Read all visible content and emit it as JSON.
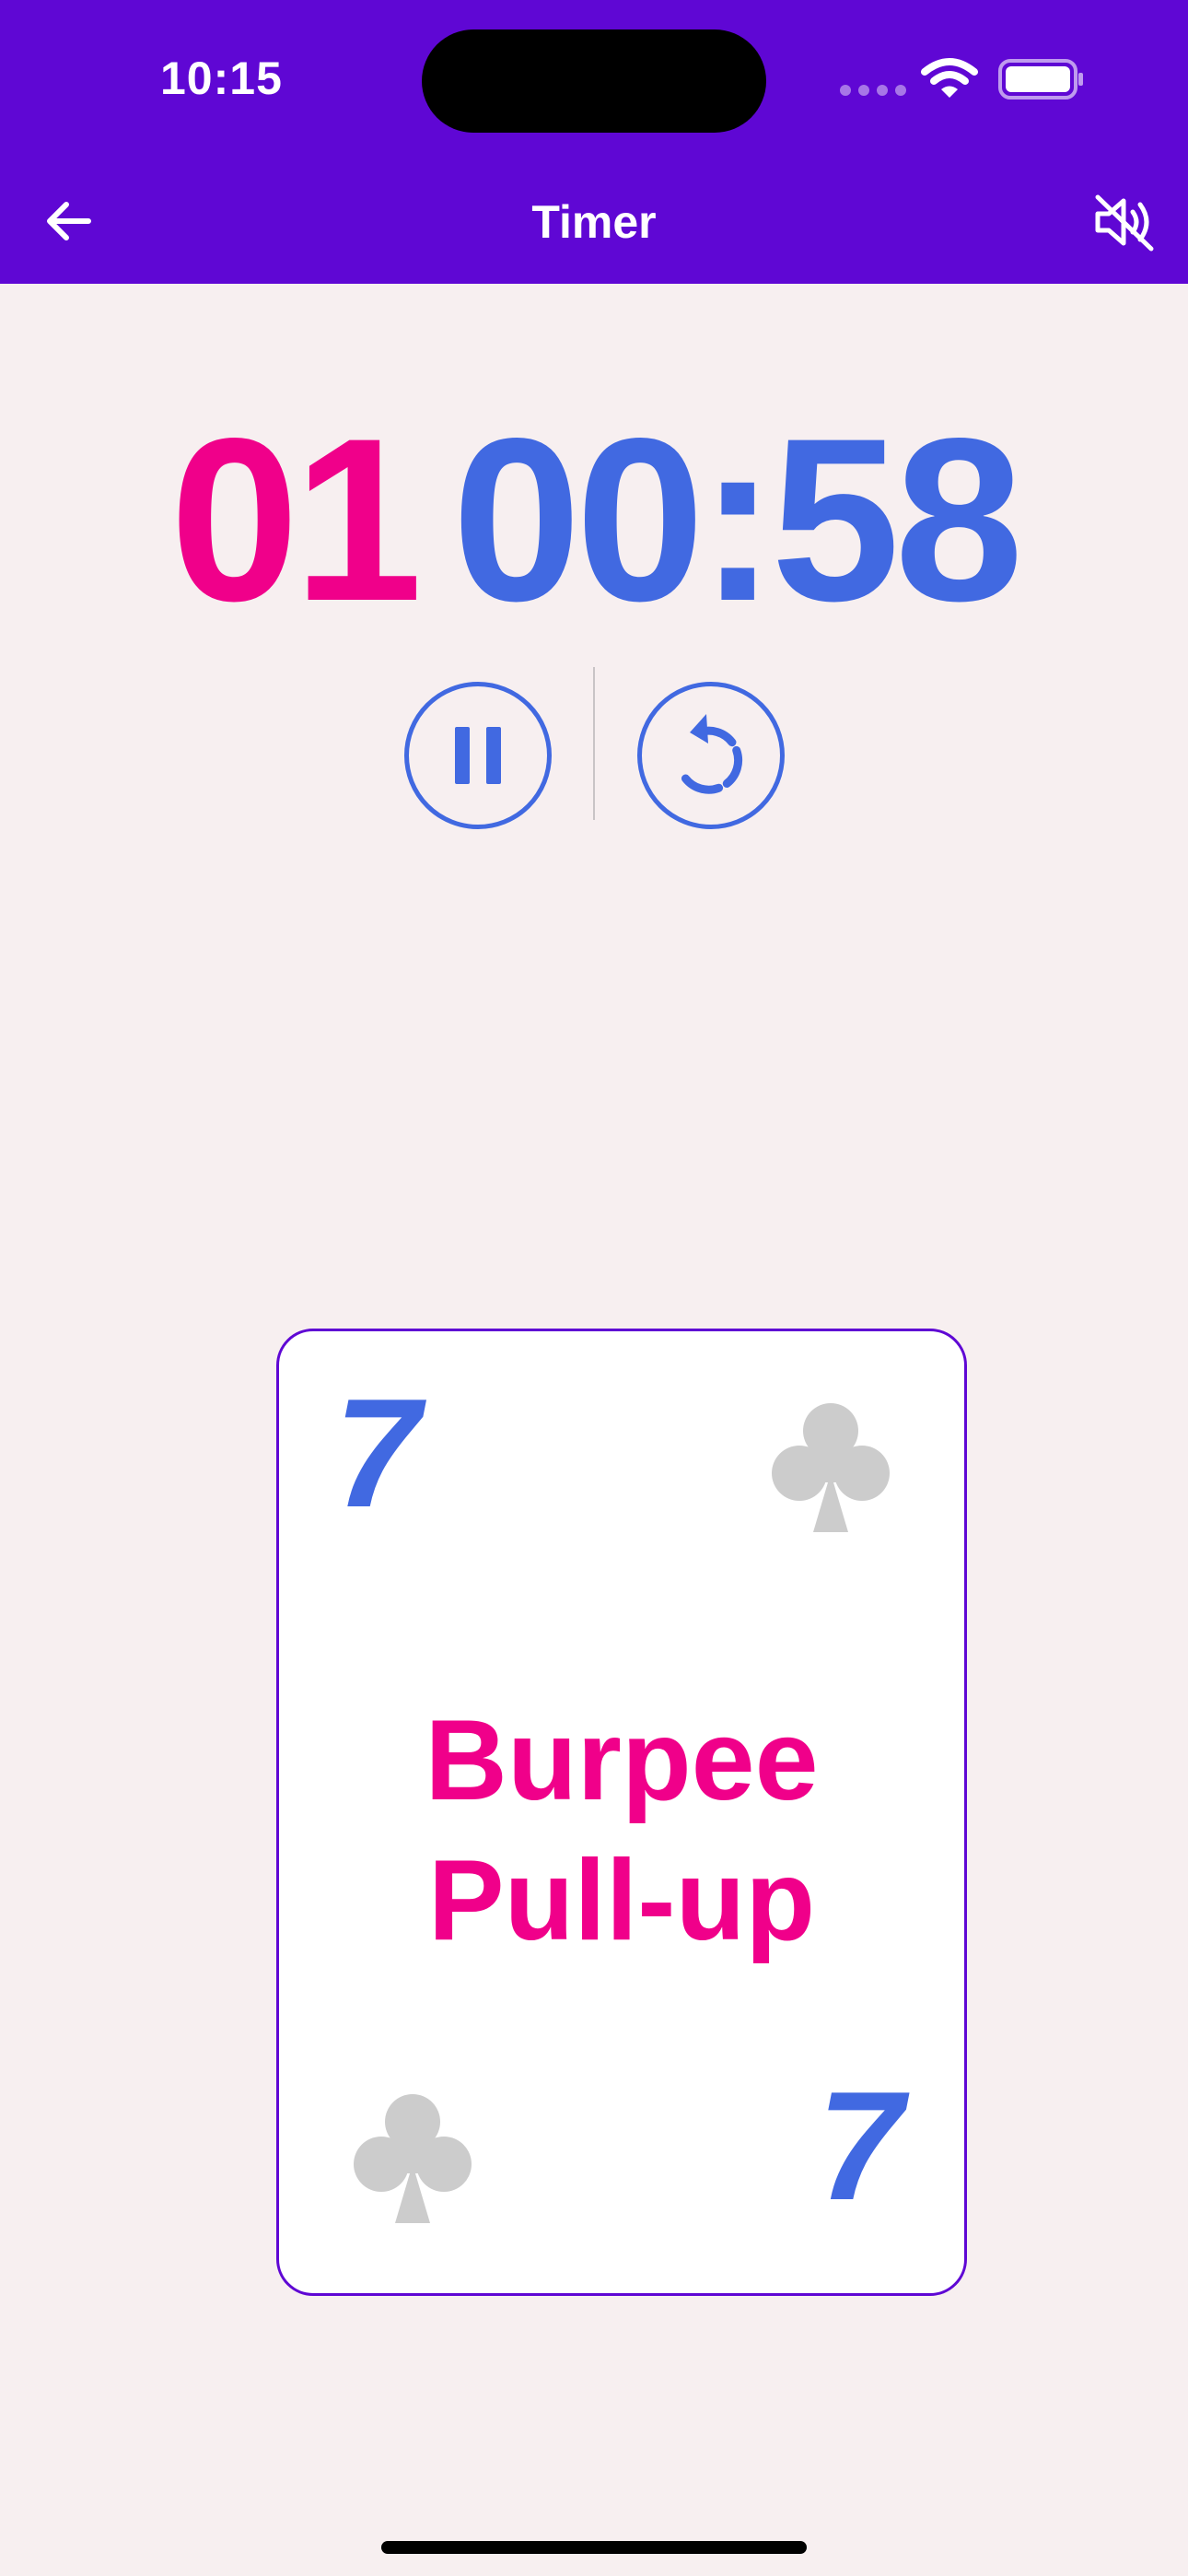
{
  "status_bar": {
    "time": "10:15"
  },
  "nav": {
    "title": "Timer",
    "back_icon": "arrow-left-icon",
    "mute_icon": "speaker-muted-icon"
  },
  "timer": {
    "rounds": "01",
    "clock": "00:58",
    "pause_icon": "pause-icon",
    "reset_icon": "reset-icon"
  },
  "card": {
    "rank": "7",
    "suit": "clubs",
    "exercise_line1": "Burpee",
    "exercise_line2": "Pull-up"
  },
  "colors": {
    "header": "#5f07d4",
    "background": "#f7eff0",
    "accent_pink": "#f0008a",
    "accent_blue": "#4169e1",
    "suit_gray": "#cccccc"
  }
}
